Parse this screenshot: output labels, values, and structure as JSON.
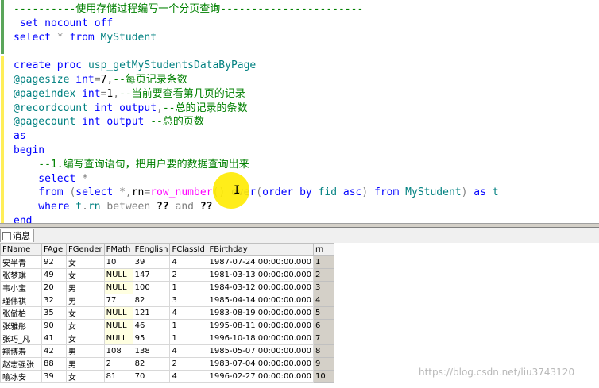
{
  "editor": {
    "lines": [
      [
        {
          "t": "----------使用存储过程编写一个分页查询-----------------------",
          "c": "cm"
        }
      ],
      [
        {
          "t": " set ",
          "c": "kw"
        },
        {
          "t": "nocount ",
          "c": "kw"
        },
        {
          "t": "off",
          "c": "kw"
        }
      ],
      [
        {
          "t": "select ",
          "c": "kw"
        },
        {
          "t": "* ",
          "c": "gy"
        },
        {
          "t": "from ",
          "c": "kw"
        },
        {
          "t": "MyStudent",
          "c": "ob"
        }
      ],
      [
        {
          "t": "",
          "c": ""
        }
      ],
      [
        {
          "t": "create ",
          "c": "kw"
        },
        {
          "t": "proc ",
          "c": "kw"
        },
        {
          "t": "usp_getMyStudentsDataByPage",
          "c": "ob"
        }
      ],
      [
        {
          "t": "@pagesize ",
          "c": "vr"
        },
        {
          "t": "int",
          "c": "kw"
        },
        {
          "t": "=",
          "c": "gy"
        },
        {
          "t": "7",
          "c": ""
        },
        {
          "t": ",",
          "c": "gy"
        },
        {
          "t": "--每页记录条数",
          "c": "cm"
        }
      ],
      [
        {
          "t": "@pageindex ",
          "c": "vr"
        },
        {
          "t": "int",
          "c": "kw"
        },
        {
          "t": "=",
          "c": "gy"
        },
        {
          "t": "1",
          "c": ""
        },
        {
          "t": ",",
          "c": "gy"
        },
        {
          "t": "--当前要查看第几页的记录",
          "c": "cm"
        }
      ],
      [
        {
          "t": "@recordcount ",
          "c": "vr"
        },
        {
          "t": "int ",
          "c": "kw"
        },
        {
          "t": "output",
          "c": "kw"
        },
        {
          "t": ",",
          "c": "gy"
        },
        {
          "t": "--总的记录的条数",
          "c": "cm"
        }
      ],
      [
        {
          "t": "@pagecount ",
          "c": "vr"
        },
        {
          "t": "int ",
          "c": "kw"
        },
        {
          "t": "output ",
          "c": "kw"
        },
        {
          "t": "--总的页数",
          "c": "cm"
        }
      ],
      [
        {
          "t": "as",
          "c": "kw"
        }
      ],
      [
        {
          "t": "begin",
          "c": "kw"
        }
      ],
      [
        {
          "t": "    --1.编写查询语句，把用户要的数据查询出来",
          "c": "cm"
        }
      ],
      [
        {
          "t": "    select ",
          "c": "kw"
        },
        {
          "t": "*",
          "c": "gy"
        }
      ],
      [
        {
          "t": "    from ",
          "c": "kw"
        },
        {
          "t": "(",
          "c": "gy"
        },
        {
          "t": "select ",
          "c": "kw"
        },
        {
          "t": "*,",
          "c": "gy"
        },
        {
          "t": "rn",
          "c": ""
        },
        {
          "t": "=",
          "c": "gy"
        },
        {
          "t": "row_number",
          "c": "fn"
        },
        {
          "t": "() ",
          "c": "gy"
        },
        {
          "t": "over",
          "c": "kw"
        },
        {
          "t": "(",
          "c": "gy"
        },
        {
          "t": "order ",
          "c": "kw"
        },
        {
          "t": "by ",
          "c": "kw"
        },
        {
          "t": "fid ",
          "c": "ob"
        },
        {
          "t": "asc",
          "c": "kw"
        },
        {
          "t": ") ",
          "c": "gy"
        },
        {
          "t": "from ",
          "c": "kw"
        },
        {
          "t": "MyStudent",
          "c": "ob"
        },
        {
          "t": ") ",
          "c": "gy"
        },
        {
          "t": "as ",
          "c": "kw"
        },
        {
          "t": "t",
          "c": "ob"
        }
      ],
      [
        {
          "t": "    where ",
          "c": "kw"
        },
        {
          "t": "t",
          "c": "ob"
        },
        {
          "t": ".",
          "c": "gy"
        },
        {
          "t": "rn ",
          "c": "ob"
        },
        {
          "t": "between ",
          "c": "gy"
        },
        {
          "t": "?? ",
          "c": "bd"
        },
        {
          "t": "and ",
          "c": "gy"
        },
        {
          "t": "??",
          "c": "bd"
        }
      ],
      [
        {
          "t": "end",
          "c": "kw"
        }
      ]
    ],
    "cursor_glyph": "I"
  },
  "tabs": {
    "results_label": "",
    "messages_label": "消息"
  },
  "grid": {
    "columns": [
      "FName",
      "FAge",
      "FGender",
      "FMath",
      "FEnglish",
      "FClassId",
      "FBirthday",
      "rn"
    ],
    "rows": [
      [
        "安半青",
        "92",
        "女",
        "10",
        "39",
        "4",
        "1987-07-24 00:00:00.000",
        "1"
      ],
      [
        "张梦琪",
        "49",
        "女",
        "NULL",
        "147",
        "2",
        "1981-03-13 00:00:00.000",
        "2"
      ],
      [
        "韦小宝",
        "20",
        "男",
        "NULL",
        "100",
        "1",
        "1984-03-12 00:00:00.000",
        "3"
      ],
      [
        "瑾伟祺",
        "32",
        "男",
        "77",
        "82",
        "3",
        "1985-04-14 00:00:00.000",
        "4"
      ],
      [
        "张傲柏",
        "35",
        "女",
        "NULL",
        "121",
        "4",
        "1983-08-19 00:00:00.000",
        "5"
      ],
      [
        "张雅彤",
        "90",
        "女",
        "NULL",
        "46",
        "1",
        "1995-08-11 00:00:00.000",
        "6"
      ],
      [
        "张巧_凡",
        "41",
        "女",
        "NULL",
        "95",
        "1",
        "1996-10-18 00:00:00.000",
        "7"
      ],
      [
        "翔博寿",
        "42",
        "男",
        "108",
        "138",
        "4",
        "1985-05-07 00:00:00.000",
        "8"
      ],
      [
        "赵志强张",
        "88",
        "男",
        "2",
        "82",
        "2",
        "1983-07-04 00:00:00.000",
        "9"
      ],
      [
        "喻冰安",
        "39",
        "女",
        "81",
        "70",
        "4",
        "1996-02-27 00:00:00.000",
        "10"
      ]
    ]
  },
  "watermark": "https://blog.csdn.net/liu3743120",
  "colors": {
    "keyword": "#0000ff",
    "comment": "#008000",
    "object": "#008080",
    "operator": "#808080",
    "function": "#ff00ff",
    "cursor_highlight": "#ffeb00",
    "null_cell": "#ffffe1"
  }
}
